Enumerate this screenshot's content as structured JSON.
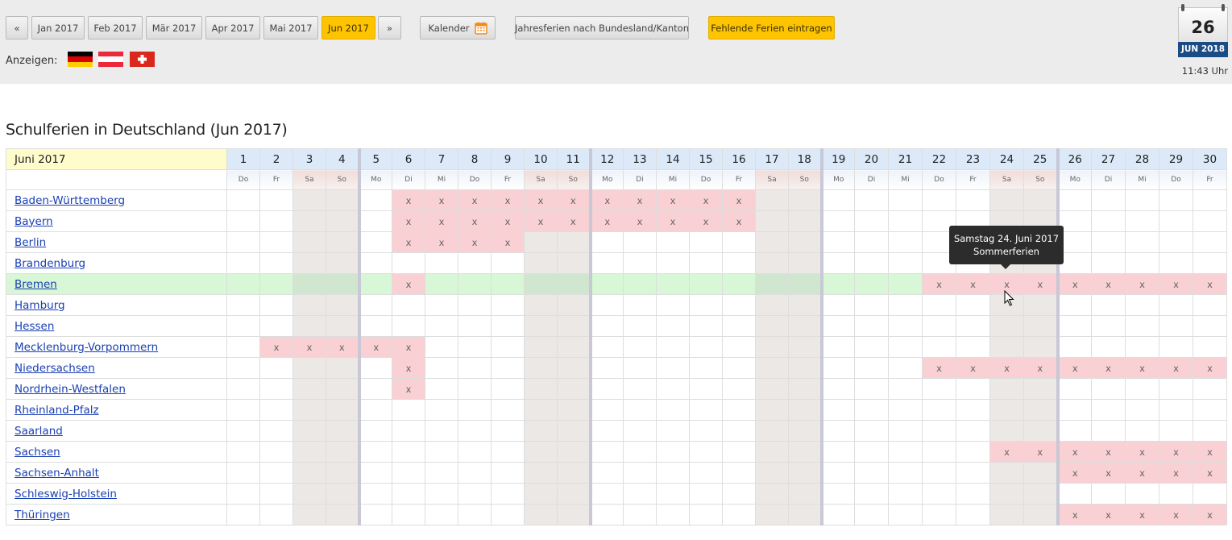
{
  "nav": {
    "prev": "«",
    "next": "»",
    "months": [
      "Jan 2017",
      "Feb 2017",
      "Mär 2017",
      "Apr 2017",
      "Mai 2017",
      "Jun 2017"
    ],
    "active_month": "Jun 2017",
    "calendar_label": "Kalender",
    "jahresferien_label": "Jahresferien nach Bundesland/Kanton",
    "fehlende_label": "Fehlende Ferien eintragen"
  },
  "show": {
    "label": "Anzeigen:",
    "flags": [
      "germany-flag-icon",
      "austria-flag-icon",
      "switzerland-flag-icon"
    ]
  },
  "today_widget": {
    "day": "26",
    "month_year": "JUN 2018",
    "time": "11:43 Uhr"
  },
  "page_title": "Schulferien in Deutschland (Jun 2017)",
  "table": {
    "month_label": "Juni 2017",
    "days": [
      {
        "n": "1",
        "d": "Do"
      },
      {
        "n": "2",
        "d": "Fr"
      },
      {
        "n": "3",
        "d": "Sa"
      },
      {
        "n": "4",
        "d": "So"
      },
      {
        "n": "5",
        "d": "Mo"
      },
      {
        "n": "6",
        "d": "Di"
      },
      {
        "n": "7",
        "d": "Mi"
      },
      {
        "n": "8",
        "d": "Do"
      },
      {
        "n": "9",
        "d": "Fr"
      },
      {
        "n": "10",
        "d": "Sa"
      },
      {
        "n": "11",
        "d": "So"
      },
      {
        "n": "12",
        "d": "Mo"
      },
      {
        "n": "13",
        "d": "Di"
      },
      {
        "n": "14",
        "d": "Mi"
      },
      {
        "n": "15",
        "d": "Do"
      },
      {
        "n": "16",
        "d": "Fr"
      },
      {
        "n": "17",
        "d": "Sa"
      },
      {
        "n": "18",
        "d": "So"
      },
      {
        "n": "19",
        "d": "Mo"
      },
      {
        "n": "20",
        "d": "Di"
      },
      {
        "n": "21",
        "d": "Mi"
      },
      {
        "n": "22",
        "d": "Do"
      },
      {
        "n": "23",
        "d": "Fr"
      },
      {
        "n": "24",
        "d": "Sa"
      },
      {
        "n": "25",
        "d": "So"
      },
      {
        "n": "26",
        "d": "Mo"
      },
      {
        "n": "27",
        "d": "Di"
      },
      {
        "n": "28",
        "d": "Mi"
      },
      {
        "n": "29",
        "d": "Do"
      },
      {
        "n": "30",
        "d": "Fr"
      }
    ],
    "holiday_mark": "x",
    "highlighted_state": "Bremen",
    "states": [
      {
        "name": "Baden-Württemberg",
        "holidays": [
          6,
          7,
          8,
          9,
          10,
          11,
          12,
          13,
          14,
          15,
          16
        ]
      },
      {
        "name": "Bayern",
        "holidays": [
          6,
          7,
          8,
          9,
          10,
          11,
          12,
          13,
          14,
          15,
          16
        ]
      },
      {
        "name": "Berlin",
        "holidays": [
          6,
          7,
          8,
          9
        ]
      },
      {
        "name": "Brandenburg",
        "holidays": []
      },
      {
        "name": "Bremen",
        "holidays": [
          6,
          22,
          23,
          24,
          25,
          26,
          27,
          28,
          29,
          30
        ]
      },
      {
        "name": "Hamburg",
        "holidays": []
      },
      {
        "name": "Hessen",
        "holidays": []
      },
      {
        "name": "Mecklenburg-Vorpommern",
        "holidays": [
          2,
          3,
          4,
          5,
          6
        ]
      },
      {
        "name": "Niedersachsen",
        "holidays": [
          6,
          22,
          23,
          24,
          25,
          26,
          27,
          28,
          29,
          30
        ]
      },
      {
        "name": "Nordrhein-Westfalen",
        "holidays": [
          6
        ]
      },
      {
        "name": "Rheinland-Pfalz",
        "holidays": []
      },
      {
        "name": "Saarland",
        "holidays": []
      },
      {
        "name": "Sachsen",
        "holidays": [
          24,
          25,
          26,
          27,
          28,
          29,
          30
        ]
      },
      {
        "name": "Sachsen-Anhalt",
        "holidays": [
          26,
          27,
          28,
          29,
          30
        ]
      },
      {
        "name": "Schleswig-Holstein",
        "holidays": []
      },
      {
        "name": "Thüringen",
        "holidays": [
          26,
          27,
          28,
          29,
          30
        ]
      }
    ]
  },
  "tooltip": {
    "line1": "Samstag 24. Juni 2017",
    "line2": "Sommerferien"
  },
  "colors": {
    "accent": "#ffc400",
    "holiday": "#f9d0d3",
    "weekend": "#ece8e5",
    "highlight_row": "#d7f7d6",
    "link": "#1a3fb3"
  }
}
